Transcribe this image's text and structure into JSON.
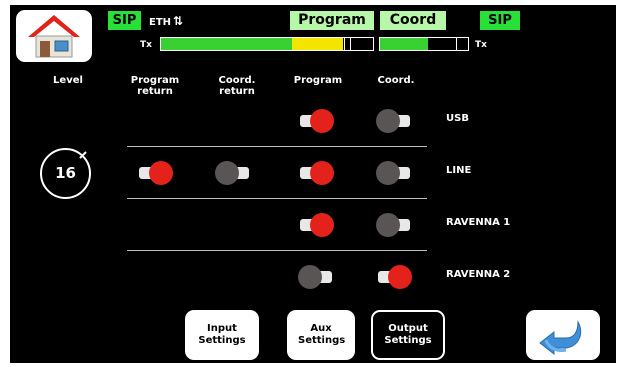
{
  "status": {
    "sip_left": "SIP",
    "eth_label": "ETH",
    "eth_icon": "up-down-arrows-icon",
    "program_badge": "Program",
    "coord_badge": "Coord",
    "sip_right": "SIP",
    "tx_left": "Tx",
    "tx_right": "Tx",
    "program_meter": {
      "green_fraction": 0.62,
      "yellow_fraction": 0.86
    },
    "coord_meter": {
      "green_fraction": 0.55
    }
  },
  "headers": {
    "level": "Level",
    "program_return": "Program return",
    "coord_return": "Coord. return",
    "program": "Program",
    "coord": "Coord."
  },
  "level": {
    "value": "16"
  },
  "rows": [
    {
      "label": "USB",
      "program_return": null,
      "coord_return": null,
      "program": true,
      "coord": false
    },
    {
      "label": "LINE",
      "program_return": true,
      "coord_return": false,
      "program": true,
      "coord": false
    },
    {
      "label": "RAVENNA 1",
      "program_return": null,
      "coord_return": null,
      "program": true,
      "coord": false
    },
    {
      "label": "RAVENNA 2",
      "program_return": null,
      "coord_return": null,
      "program": false,
      "coord": true
    }
  ],
  "bottom": {
    "input_settings": "Input Settings",
    "aux_settings": "Aux Settings",
    "output_settings": "Output Settings",
    "home_icon": "home-icon",
    "back_icon": "back-arrow-icon"
  },
  "colors": {
    "on": "#e3231b",
    "off": "#5a5555",
    "badge_green": "#29e039",
    "badge_light": "#b6f7a9",
    "meter_green": "#39d032",
    "meter_yellow": "#f2e600"
  }
}
